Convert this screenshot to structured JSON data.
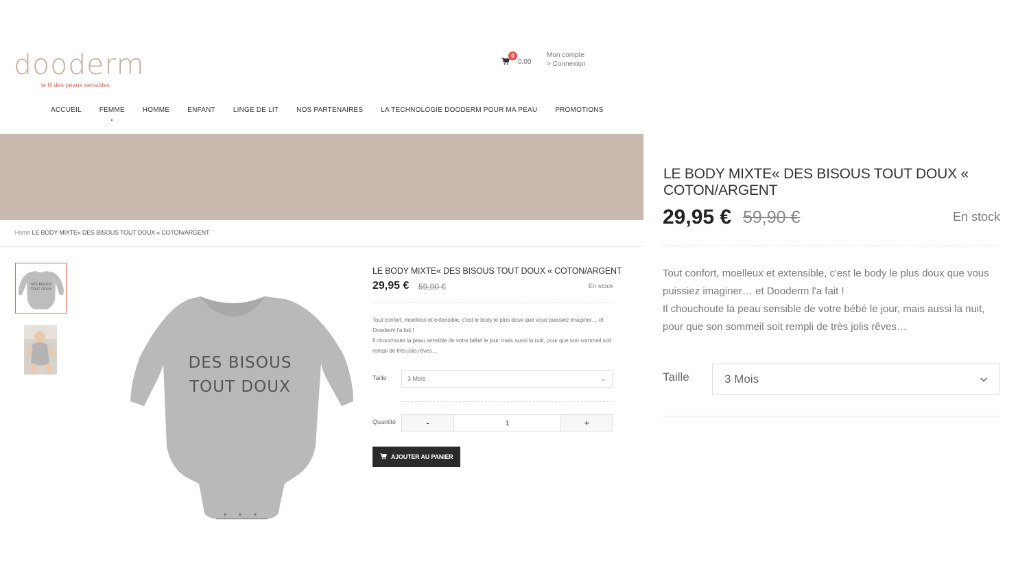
{
  "logo": {
    "word": "dooderm",
    "tagline": "le fil des peaux sensibles"
  },
  "cart": {
    "count": "0",
    "total": "0.00"
  },
  "account": {
    "line1": "Mon compte",
    "line2": "> Connexion"
  },
  "nav": [
    "ACCUEIL",
    "FEMME",
    "HOMME",
    "ENFANT",
    "LINGE DE LIT",
    "NOS PARTENAIRES",
    "LA TECHNOLOGIE DOODERM POUR MA PEAU",
    "PROMOTIONS"
  ],
  "colors": {
    "brand": "#c7a99a",
    "accent": "#d36a5e",
    "banner": "#c9b8ad",
    "badge": "#e0544c",
    "button": "#2b2b2b"
  },
  "breadcrumb": {
    "home": "Home",
    "current": "LE BODY MIXTE« DES BISOUS TOUT DOUX « COTON/ARGENT"
  },
  "product": {
    "print_text": [
      "DES BISOUS",
      "TOUT DOUX"
    ],
    "title": "LE BODY MIXTE« DES BISOUS TOUT DOUX « COTON/ARGENT",
    "price": "29,95 €",
    "old_price": "59,90 €",
    "stock": "En stock",
    "description_sm": [
      "Tout confort, moelleux et extensible, c'est le body le plus doux que vous puissiez imaginer… et Dooderm l'a fait !",
      "Il chouchoute la peau sensible de votre bébé le jour, mais aussi la nuit, pour que son sommeil soit rempli de très jolis rêves…"
    ],
    "description": [
      "Tout confort, moelleux et extensible, c'est le body le plus doux que vous puissiez imaginer… et Dooderm l'a fait !",
      "Il chouchoute la peau sensible de votre bébé le jour, mais aussi la nuit, pour que son sommeil soit rempli de très jolis rêves…"
    ],
    "size_label": "Taille",
    "size_value": "3 Mois",
    "qty_label": "Quantité",
    "qty_value": "1",
    "qty_minus": "-",
    "qty_plus": "+",
    "add_to_cart": "AJOUTER AU PANIER"
  }
}
